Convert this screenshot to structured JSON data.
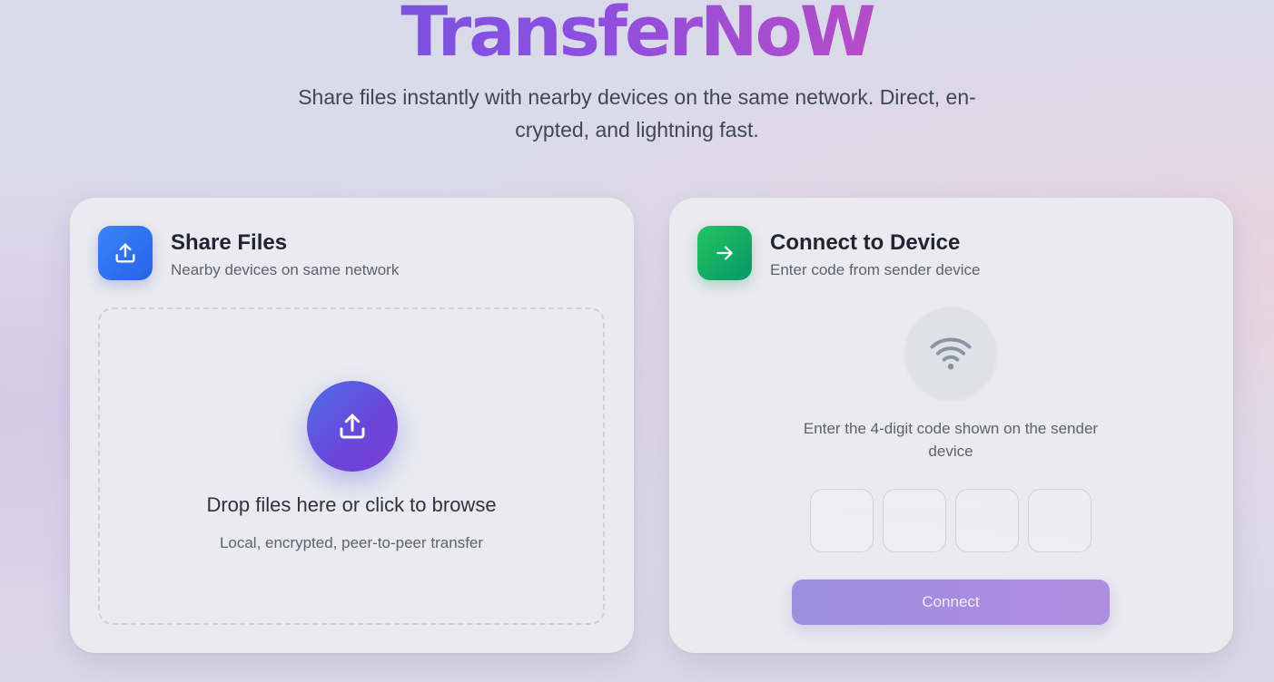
{
  "app": {
    "brand": [
      "Transfer",
      "NoW"
    ],
    "tagline_line1": "Share files instantly with nearby devices on the same network. Direct, en-",
    "tagline_line2": "crypted, and lightning fast."
  },
  "share_card": {
    "icon": "upload-icon",
    "title": "Share Files",
    "subtitle": "Nearby devices on same network",
    "dropzone": {
      "icon": "upload-icon",
      "title": "Drop files here or click to browse",
      "subtitle": "Local, encrypted, peer-to-peer transfer"
    }
  },
  "connect_card": {
    "icon": "arrow-right-icon",
    "title": "Connect to Device",
    "subtitle": "Enter code from sender device",
    "status_icon": "wifi-icon",
    "hint_line1": "Enter the 4-digit code shown on the sender",
    "hint_line2": "device",
    "code_digits": [
      "",
      "",
      "",
      ""
    ],
    "connect_label": "Connect"
  },
  "colors": {
    "accent_blue": "#2563eb",
    "accent_green": "#16a34a",
    "brand_gradient_start": "#5b5bdc",
    "brand_gradient_end": "#e04a9a",
    "connect_button": "#a78ce0"
  }
}
